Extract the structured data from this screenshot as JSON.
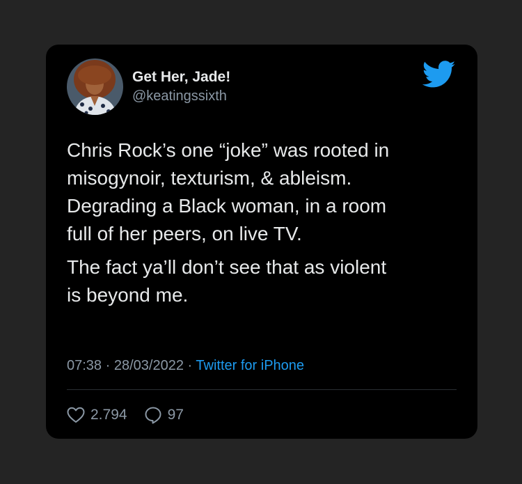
{
  "tweet": {
    "author": {
      "display_name": "Get Her, Jade!",
      "handle": "@keatingssixth"
    },
    "paragraphs": [
      [
        "Chris Rock’s one “joke” was rooted in",
        "misogynoir, texturism, & ableism.",
        "Degrading a Black woman, in a room",
        "full of her peers, on live TV."
      ],
      [
        "The fact ya’ll don’t see that as violent",
        "is beyond me."
      ]
    ],
    "time": "07:38",
    "date": "28/03/2022",
    "separator": "·",
    "source": "Twitter for iPhone",
    "likes": "2.794",
    "replies": "97"
  },
  "icons": {
    "logo": "twitter-bird-icon",
    "like": "heart-icon",
    "reply": "comment-bubble-icon"
  },
  "colors": {
    "background": "#242424",
    "card": "#000000",
    "text": "#e7e9ea",
    "muted": "#8b98a5",
    "accent": "#1d9bf0"
  }
}
